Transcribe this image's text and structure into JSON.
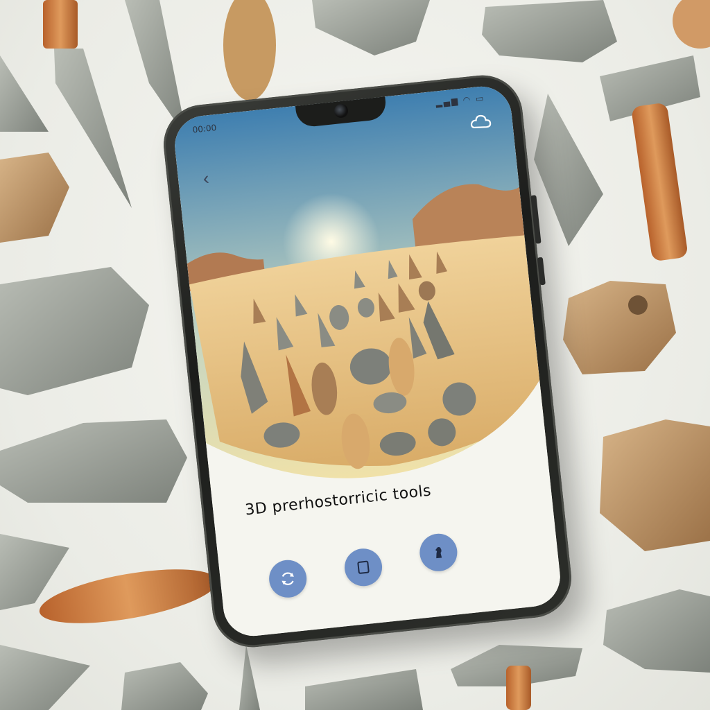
{
  "status_bar": {
    "left_text": "00:00",
    "right_icons": [
      "signal-icon",
      "wifi-icon",
      "battery-icon"
    ]
  },
  "header": {
    "back_icon": "chevron-left-icon",
    "profile_icon": "cloud-icon"
  },
  "main": {
    "title": "3D prerhostorricic  tools"
  },
  "bottom_nav": [
    {
      "icon": "rotate-icon"
    },
    {
      "icon": "square-icon"
    },
    {
      "icon": "chess-piece-icon"
    }
  ],
  "colors": {
    "sky_top": "#3f7fb0",
    "sky_bottom": "#f7e3a4",
    "sand": "#e4bf7f",
    "nav_button": "#6e8fc6",
    "phone_frame": "#1c1d1b"
  }
}
